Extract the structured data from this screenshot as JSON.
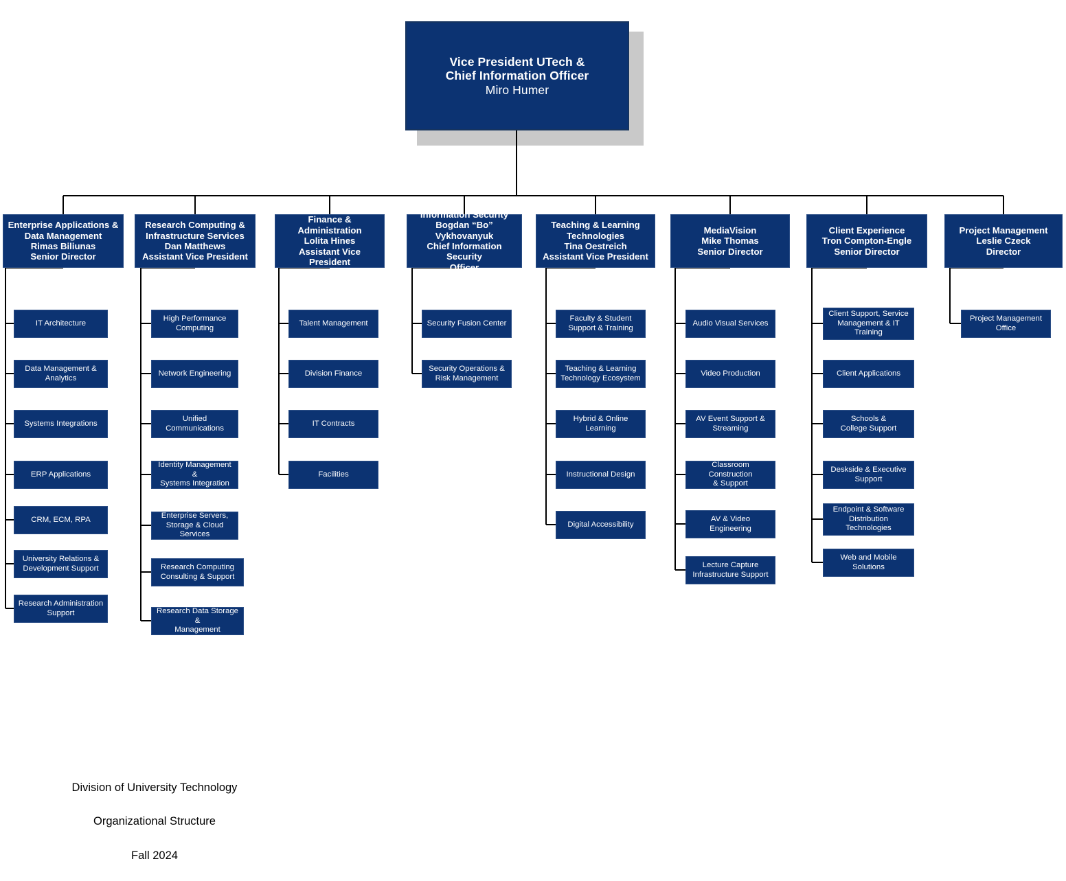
{
  "meta": {
    "colors": {
      "box_fill": "#0c3372",
      "box_border": "#2a4d85",
      "box_text": "#ffffff",
      "line": "#000000",
      "shadow": "#c9c9c9",
      "background": "#ffffff",
      "caption_text": "#000000"
    }
  },
  "root": {
    "line1": "Vice President UTech &",
    "line2": "Chief Information Officer",
    "line3": "Miro Humer"
  },
  "departments": [
    {
      "id": "enterprise-applications-data-management",
      "name": "Enterprise Applications &\nData Management",
      "person": "Rimas Biliunas",
      "title": "Senior Director",
      "children": [
        "IT Architecture",
        "Data Management &\nAnalytics",
        "Systems Integrations",
        "ERP Applications",
        "CRM, ECM, RPA",
        "University Relations &\nDevelopment Support",
        "Research Administration\nSupport"
      ]
    },
    {
      "id": "research-computing-infrastructure-services",
      "name": "Research Computing &\nInfrastructure Services",
      "person": "Dan Matthews",
      "title": "Assistant Vice President",
      "children": [
        "High Performance\nComputing",
        "Network Engineering",
        "Unified Communications",
        "Identity Management &\nSystems Integration",
        "Enterprise Servers,\nStorage & Cloud Services",
        "Research Computing\nConsulting & Support",
        "Research Data Storage &\nManagement"
      ]
    },
    {
      "id": "finance-administration",
      "name": "Finance &\nAdministration",
      "person": "Lolita Hines",
      "title": "Assistant Vice President",
      "children": [
        "Talent Management",
        "Division Finance",
        "IT Contracts",
        "Facilities"
      ]
    },
    {
      "id": "information-security",
      "name": "Information Security",
      "person": "Bogdan “Bo” Vykhovanyuk",
      "title": "Chief Information Security\nOfficer",
      "children": [
        "Security Fusion Center",
        "Security Operations &\nRisk Management"
      ]
    },
    {
      "id": "teaching-learning-technologies",
      "name": "Teaching & Learning\nTechnologies",
      "person": "Tina Oestreich",
      "title": "Assistant Vice President",
      "children": [
        "Faculty & Student\nSupport & Training",
        "Teaching & Learning\nTechnology Ecosystem",
        "Hybrid & Online Learning",
        "Instructional Design",
        "Digital Accessibility"
      ]
    },
    {
      "id": "mediavision",
      "name": "MediaVision",
      "person": "Mike Thomas",
      "title": "Senior Director",
      "children": [
        "Audio Visual Services",
        "Video Production",
        "AV Event Support &\nStreaming",
        "Classroom Construction\n& Support",
        "AV & Video Engineering",
        "Lecture Capture\nInfrastructure Support"
      ]
    },
    {
      "id": "client-experience",
      "name": "Client Experience",
      "person": "Tron Compton-Engle",
      "title": "Senior Director",
      "children": [
        "Client Support, Service\nManagement & IT\nTraining",
        "Client Applications",
        "Schools &\nCollege Support",
        "Deskside & Executive\nSupport",
        "Endpoint & Software\nDistribution\nTechnologies",
        "Web and Mobile\nSolutions"
      ]
    },
    {
      "id": "project-management",
      "name": "Project Management",
      "person": "Leslie Czeck",
      "title": "Director",
      "children": [
        "Project Management\nOffice"
      ]
    }
  ],
  "caption": {
    "line1": "Division of University Technology",
    "line2": "Organizational Structure",
    "line3": "Fall 2024"
  }
}
